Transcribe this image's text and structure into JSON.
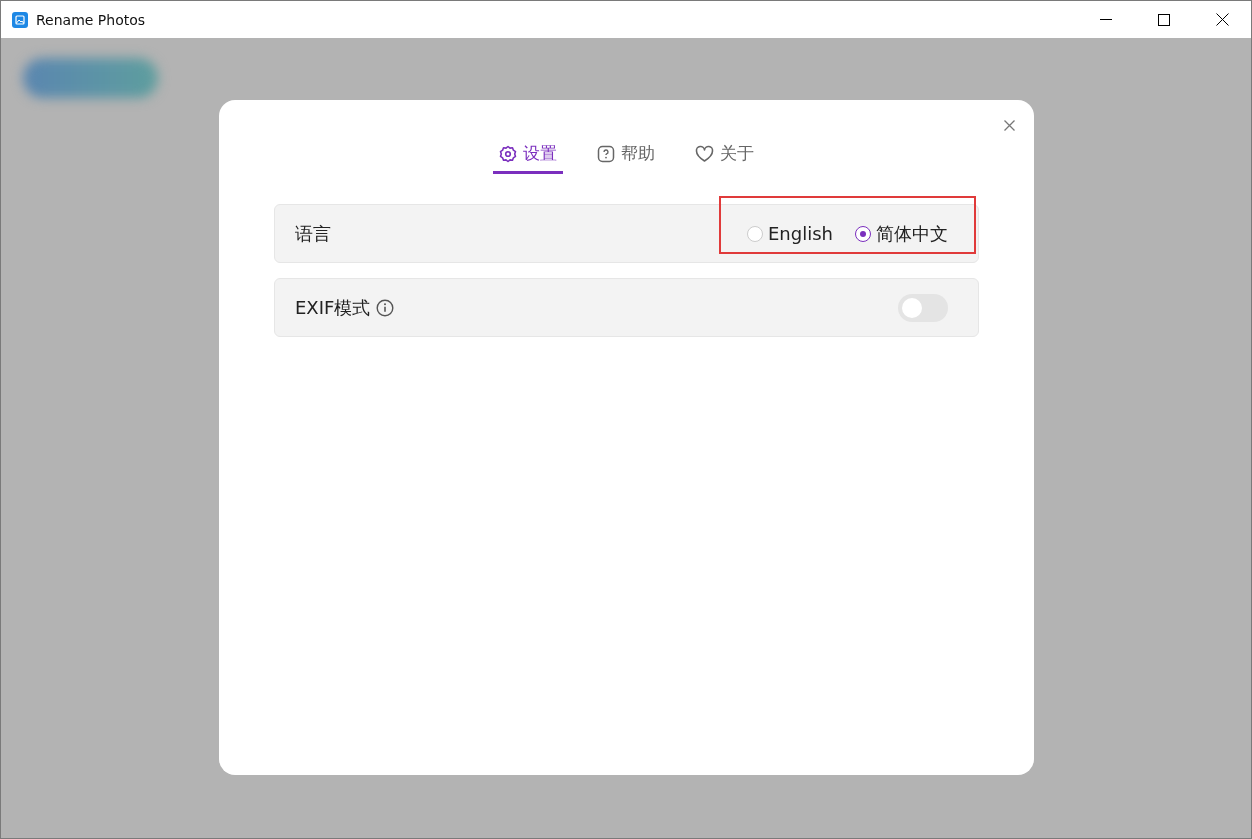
{
  "window": {
    "title": "Rename Photos"
  },
  "dialog": {
    "tabs": [
      {
        "label": "设置",
        "kind": "gear",
        "selected": true
      },
      {
        "label": "帮助",
        "kind": "help",
        "selected": false
      },
      {
        "label": "关于",
        "kind": "heart",
        "selected": false
      }
    ],
    "settings": [
      {
        "kind": "radio",
        "label": "语言",
        "highlighted": true,
        "options": [
          {
            "label": "English",
            "selected": false
          },
          {
            "label": "简体中文",
            "selected": true
          }
        ]
      },
      {
        "kind": "toggle",
        "label": "EXIF模式",
        "info": true,
        "on": false
      }
    ]
  }
}
